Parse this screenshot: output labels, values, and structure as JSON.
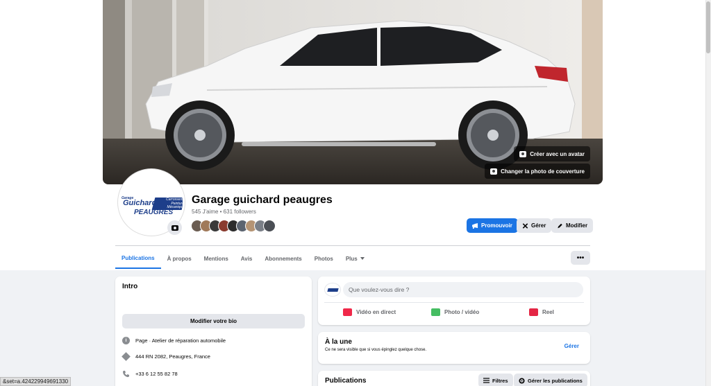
{
  "page": {
    "name": "Garage guichard peaugres",
    "stats": "545 J'aime • 631 followers"
  },
  "cover": {
    "avatar_button": "Créer avec un avatar",
    "change_button": "Changer la photo de couverture"
  },
  "logo": {
    "garage": "Garage",
    "guichard": "Guichard",
    "services": [
      "Carrosserie",
      "Peinture",
      "Mécanique"
    ],
    "town": "PEAUGRES"
  },
  "actions": {
    "promote": "Promouvoir",
    "manage": "Gérer",
    "edit": "Modifier"
  },
  "tabs": [
    {
      "label": "Publications",
      "active": true
    },
    {
      "label": "À propos"
    },
    {
      "label": "Mentions"
    },
    {
      "label": "Avis"
    },
    {
      "label": "Abonnements"
    },
    {
      "label": "Photos"
    },
    {
      "label": "Plus"
    }
  ],
  "more_button": "•••",
  "intro": {
    "title": "Intro",
    "bio_button": "Modifier votre bio",
    "category": "Page · Atelier de réparation automobile",
    "address": "444 RN 2082, Peaugres, France",
    "phone": "+33 6 12 55 82 78"
  },
  "composer": {
    "placeholder": "Que voulez-vous dire ?",
    "live": "Vidéo en direct",
    "photo": "Photo / vidéo",
    "reel": "Reel"
  },
  "featured": {
    "title": "À la une",
    "subtitle": "Ce ne sera visible que si vous épinglez quelque chose.",
    "manage": "Gérer"
  },
  "publications": {
    "title": "Publications",
    "filters": "Filtres",
    "manage": "Gérer les publications"
  },
  "status_bar": {
    "url": "&set=a.424229949691330"
  },
  "colors": {
    "accent": "#1b74e4",
    "logo_blue": "#1d3e8a",
    "background": "#f0f2f5"
  }
}
